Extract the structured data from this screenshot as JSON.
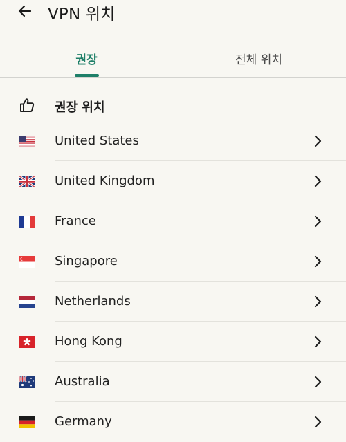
{
  "header": {
    "title": "VPN 위치",
    "back_icon": "arrow-left-icon"
  },
  "tabs": [
    {
      "label": "권장",
      "active": true
    },
    {
      "label": "전체 위치",
      "active": false
    }
  ],
  "section": {
    "title": "권장 위치",
    "icon": "thumbs-up-icon"
  },
  "countries": [
    {
      "name": "United States",
      "flag": "us"
    },
    {
      "name": "United Kingdom",
      "flag": "uk"
    },
    {
      "name": "France",
      "flag": "fr"
    },
    {
      "name": "Singapore",
      "flag": "sg"
    },
    {
      "name": "Netherlands",
      "flag": "nl"
    },
    {
      "name": "Hong Kong",
      "flag": "hk"
    },
    {
      "name": "Australia",
      "flag": "au"
    },
    {
      "name": "Germany",
      "flag": "de"
    }
  ],
  "colors": {
    "accent": "#1e7f68",
    "background": "#f8f7f2"
  }
}
